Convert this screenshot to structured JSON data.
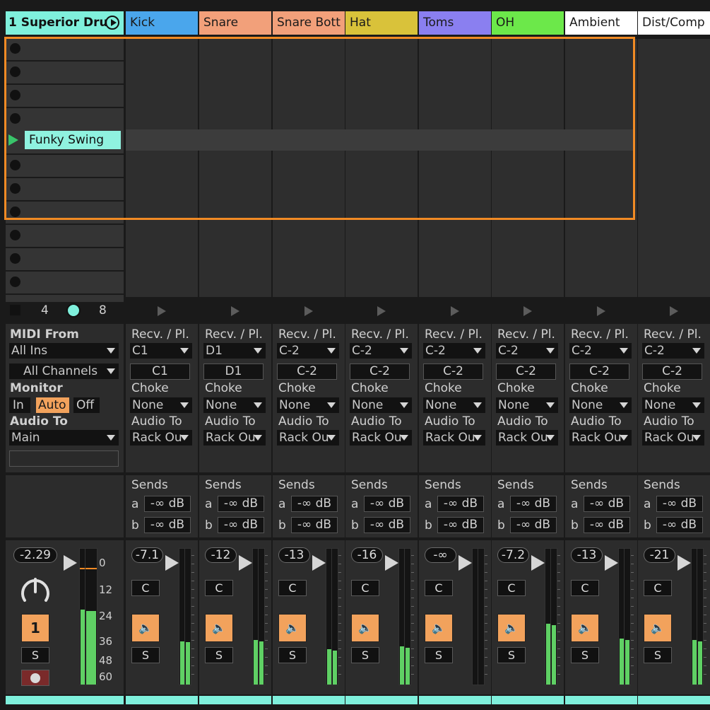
{
  "group": {
    "name": "1 Superior Dru",
    "bank_left": "4",
    "bank_right": "8",
    "midi_from_label": "MIDI From",
    "midi_from_value": "All Ins",
    "midi_channel_value": "All Channels",
    "monitor_label": "Monitor",
    "monitor_options": [
      "In",
      "Auto",
      "Off"
    ],
    "audio_to_label": "Audio To",
    "audio_to_value": "Main",
    "volume": "-2.29",
    "track_number": "1",
    "solo_label": "S",
    "db_scale": [
      "0",
      "12",
      "24",
      "36",
      "48",
      "60"
    ],
    "meter_level_left": 0.55,
    "meter_level_right": 0.54
  },
  "clip": {
    "name": "Funky Swing",
    "scene_index": 4
  },
  "chains": [
    {
      "name": "Kick",
      "color": "#4aa6ec",
      "text_color": "#1a1a1a",
      "receive": "C1",
      "play": "C1",
      "choke": "None",
      "audio_to": "Rack Ou",
      "send_a": "-∞ dB",
      "send_b": "-∞ dB",
      "volume": "-7.1",
      "pan": "C",
      "solo": "S",
      "meter_level": 0.32
    },
    {
      "name": "Snare",
      "color": "#f2a07a",
      "text_color": "#1a1a1a",
      "receive": "D1",
      "play": "D1",
      "choke": "None",
      "audio_to": "Rack Ou",
      "send_a": "-∞ dB",
      "send_b": "-∞ dB",
      "volume": "-12",
      "pan": "C",
      "solo": "S",
      "meter_level": 0.33
    },
    {
      "name": "Snare Bott",
      "color": "#f2a07a",
      "text_color": "#1a1a1a",
      "receive": "C-2",
      "play": "C-2",
      "choke": "None",
      "audio_to": "Rack Ou",
      "send_a": "-∞ dB",
      "send_b": "-∞ dB",
      "volume": "-13",
      "pan": "C",
      "solo": "S",
      "meter_level": 0.26
    },
    {
      "name": "Hat",
      "color": "#d9c23a",
      "text_color": "#1a1a1a",
      "receive": "C-2",
      "play": "C-2",
      "choke": "None",
      "audio_to": "Rack Ou",
      "send_a": "-∞ dB",
      "send_b": "-∞ dB",
      "volume": "-16",
      "pan": "C",
      "solo": "S",
      "meter_level": 0.28
    },
    {
      "name": "Toms",
      "color": "#8a7ff0",
      "text_color": "#1a1a1a",
      "receive": "C-2",
      "play": "C-2",
      "choke": "None",
      "audio_to": "Rack Ou",
      "send_a": "-∞ dB",
      "send_b": "-∞ dB",
      "volume": "-∞",
      "pan": "C",
      "solo": "S",
      "meter_level": 0.0
    },
    {
      "name": "OH",
      "color": "#6ce84a",
      "text_color": "#1a1a1a",
      "receive": "C-2",
      "play": "C-2",
      "choke": "None",
      "audio_to": "Rack Ou",
      "send_a": "-∞ dB",
      "send_b": "-∞ dB",
      "volume": "-7.2",
      "pan": "C",
      "solo": "S",
      "meter_level": 0.45
    },
    {
      "name": "Ambient",
      "color": "#ffffff",
      "text_color": "#1a1a1a",
      "receive": "C-2",
      "play": "C-2",
      "choke": "None",
      "audio_to": "Rack Ou",
      "send_a": "-∞ dB",
      "send_b": "-∞ dB",
      "volume": "-13",
      "pan": "C",
      "solo": "S",
      "meter_level": 0.34
    },
    {
      "name": "Dist/Comp",
      "color": "#ffffff",
      "text_color": "#1a1a1a",
      "receive": "C-2",
      "play": "C-2",
      "choke": "None",
      "audio_to": "Rack Ou",
      "send_a": "-∞ dB",
      "send_b": "-∞ dB",
      "volume": "-21",
      "pan": "C",
      "solo": "S",
      "meter_level": 0.33
    }
  ],
  "labels": {
    "recv_pl": "Recv. / Pl.",
    "choke": "Choke",
    "audio_to": "Audio To",
    "sends": "Sends",
    "send_a": "a",
    "send_b": "b"
  },
  "colors": {
    "accent_cyan": "#7ff0dc",
    "selection_orange": "#f08a24",
    "active_orange": "#f2a25c",
    "meter_green": "#5fd064"
  }
}
